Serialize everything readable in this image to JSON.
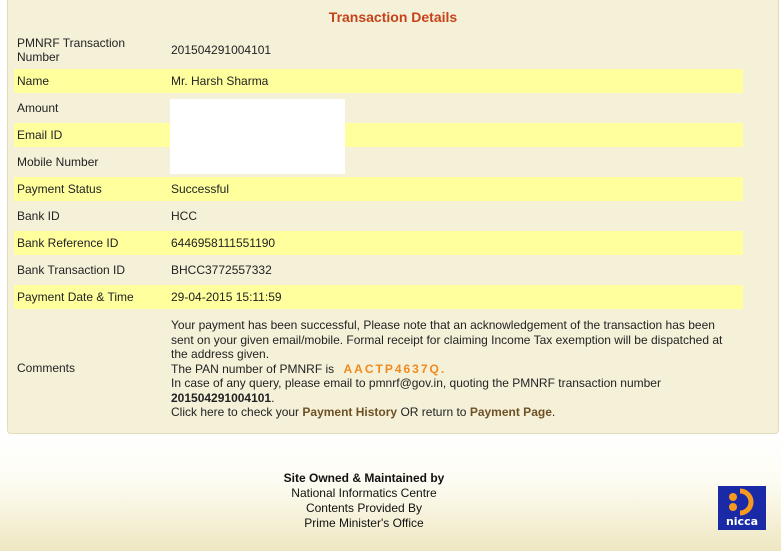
{
  "panel": {
    "title": "Transaction Details",
    "rows": [
      {
        "label": "PMNRF Transaction Number",
        "value": "201504291004101"
      },
      {
        "label": "Name",
        "value": "Mr. Harsh Sharma"
      },
      {
        "label": "Amount",
        "value": ""
      },
      {
        "label": "Email ID",
        "value": ""
      },
      {
        "label": "Mobile Number",
        "value": ""
      },
      {
        "label": "Payment Status",
        "value": "Successful"
      },
      {
        "label": "Bank ID",
        "value": "HCC"
      },
      {
        "label": "Bank Reference ID",
        "value": "6446958111551190"
      },
      {
        "label": "Bank Transaction ID",
        "value": "BHCC3772557332"
      },
      {
        "label": "Payment Date & Time",
        "value": "29-04-2015 15:11:59"
      }
    ],
    "comments": {
      "label": "Comments",
      "line1": "Your payment has been successful, Please note that an acknowledgement of the transaction has been sent on your given email/mobile. Formal receipt for claiming Income Tax exemption will be dispatched at the address given.",
      "pan_prefix": "The PAN number of PMNRF is",
      "pan": "AACTP4637Q",
      "pan_suffix": ".",
      "query_text": "In case of any query, please email to pmnrf@gov.in, quoting the PMNRF transaction number",
      "txn_number": "201504291004101",
      "txn_suffix": ".",
      "click_prefix": "Click here to check your",
      "payment_history": "Payment History",
      "or_return": "OR return to",
      "payment_page": "Payment Page",
      "end": "."
    }
  },
  "footer": {
    "line1": "Site Owned & Maintained by",
    "line2": "National Informatics Centre",
    "line3": "Contents Provided By",
    "line4": "Prime Minister's Office",
    "logo_text": "nicca"
  },
  "colors": {
    "title": "#c6431a",
    "row_highlight": "#ffff9e",
    "panel_bg": "#f5f1d9",
    "pan": "#f08a1e",
    "logo_bg": "#1a2aa6"
  }
}
